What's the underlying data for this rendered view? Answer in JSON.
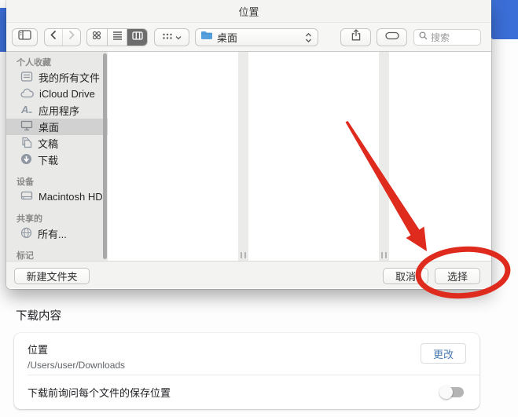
{
  "dialog": {
    "title": "位置",
    "toolbar": {
      "location": "桌面",
      "search_placeholder": "搜索"
    },
    "sidebar": {
      "favorites_header": "个人收藏",
      "favorites": [
        {
          "label": "我的所有文件",
          "icon": "all-files-icon"
        },
        {
          "label": "iCloud Drive",
          "icon": "cloud-icon"
        },
        {
          "label": "应用程序",
          "icon": "applications-icon"
        },
        {
          "label": "桌面",
          "icon": "desktop-icon"
        },
        {
          "label": "文稿",
          "icon": "documents-icon"
        },
        {
          "label": "下载",
          "icon": "download-icon"
        }
      ],
      "devices_header": "设备",
      "devices": [
        {
          "label": "Macintosh HD",
          "icon": "harddrive-icon"
        }
      ],
      "shared_header": "共享的",
      "shared": [
        {
          "label": "所有...",
          "icon": "globe-icon"
        }
      ],
      "tags_header": "标记"
    },
    "footer": {
      "new_folder": "新建文件夹",
      "cancel": "取消",
      "select": "选择"
    }
  },
  "settings": {
    "heading": "下载内容",
    "location_label": "位置",
    "location_value": "/Users/user/Downloads",
    "change_button": "更改",
    "ask_each_file": "下载前询问每个文件的保存位置",
    "ask_toggle_state": "off"
  },
  "colors": {
    "accent_blue": "#3b6ed6",
    "annotation_red": "#df2b1e",
    "change_link_blue": "#4a7ab0",
    "folder_blue": "#55a0dd"
  }
}
